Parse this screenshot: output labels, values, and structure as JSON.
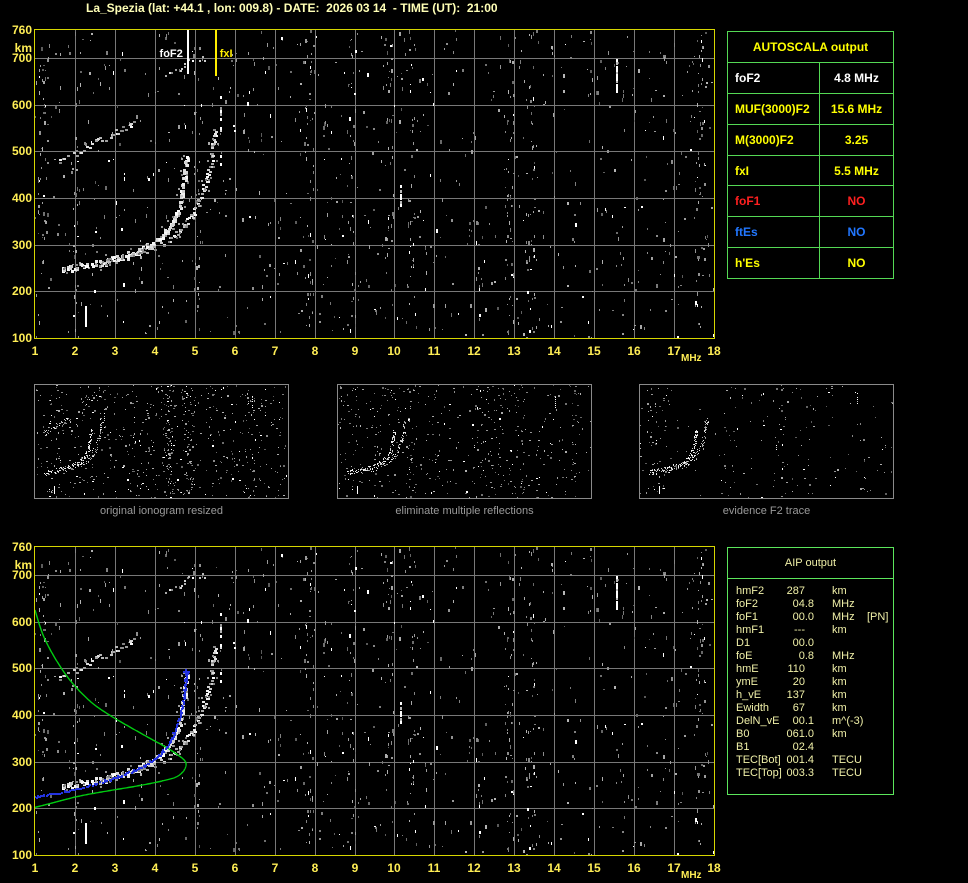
{
  "header": {
    "title": "La_Spezia (lat: +44.1 , lon: 009.8) - DATE:  2026 03 14  - TIME (UT):  21:00"
  },
  "colors": {
    "accent_yellow": "#ffee55",
    "pale_yellow": "#ffffb6",
    "plot_border": "#d6d600",
    "grid_gray": "#787878",
    "table_green": "#54d854",
    "profile_green": "#00cc11",
    "restored_blue": "#2433e0",
    "status_red": "#ff2020",
    "status_blue": "#2277ff"
  },
  "autoscala_table": {
    "title": "AUTOSCALA output",
    "rows": [
      {
        "label": "foF2",
        "value": "4.8 MHz",
        "color": "#ffffff"
      },
      {
        "label": "MUF(3000)F2",
        "value": "15.6 MHz",
        "color": "#ffff00"
      },
      {
        "label": "M(3000)F2",
        "value": "3.25",
        "color": "#ffff00"
      },
      {
        "label": "fxI",
        "value": "5.5 MHz",
        "color": "#ffff00"
      },
      {
        "label": "foF1",
        "value": "NO",
        "color": "#ff2020"
      },
      {
        "label": "ftEs",
        "value": "NO",
        "color": "#2277ff"
      },
      {
        "label": "h'Es",
        "value": "NO",
        "color": "#ffff00"
      }
    ]
  },
  "aip_table": {
    "title": "AIP output",
    "rows": [
      {
        "label": "hmF2",
        "value": "287",
        "unit": "km",
        "note": ""
      },
      {
        "label": "foF2",
        "value": "04.8",
        "unit": "MHz",
        "note": ""
      },
      {
        "label": "foF1",
        "value": "00.0",
        "unit": "MHz",
        "note": "[PN]"
      },
      {
        "label": "hmF1",
        "value": "---",
        "unit": "km",
        "note": ""
      },
      {
        "label": "D1",
        "value": "00.0",
        "unit": "",
        "note": ""
      },
      {
        "label": "foE",
        "value": "0.8",
        "unit": "MHz",
        "note": ""
      },
      {
        "label": "hmE",
        "value": "110",
        "unit": "km",
        "note": ""
      },
      {
        "label": "ymE",
        "value": "20",
        "unit": "km",
        "note": ""
      },
      {
        "label": "h_vE",
        "value": "137",
        "unit": "km",
        "note": ""
      },
      {
        "label": "Ewidth",
        "value": "67",
        "unit": "km",
        "note": ""
      },
      {
        "label": "DelN_vE",
        "value": "00.1",
        "unit": "m^(-3)",
        "note": ""
      },
      {
        "label": "B0",
        "value": "061.0",
        "unit": "km",
        "note": ""
      },
      {
        "label": "B1",
        "value": "02.4",
        "unit": "",
        "note": ""
      },
      {
        "label": "TEC[Bot]",
        "value": "001.4",
        "unit": "TECU",
        "note": ""
      },
      {
        "label": "TEC[Top]",
        "value": "003.3",
        "unit": "TECU",
        "note": ""
      }
    ]
  },
  "thumbnails": [
    {
      "caption": "original ionogram resized"
    },
    {
      "caption": "eliminate multiple reflections"
    },
    {
      "caption": "evidence F2 trace"
    }
  ],
  "chart_data": {
    "type": "scatter",
    "title": "Ionogram echo power map (two panels, identical background)",
    "xlabel": "MHz",
    "ylabel": "km",
    "xlim": [
      1,
      18
    ],
    "ylim": [
      100,
      760
    ],
    "x_ticks": [
      1,
      2,
      3,
      4,
      5,
      6,
      7,
      8,
      9,
      10,
      11,
      12,
      13,
      14,
      15,
      16,
      17,
      18
    ],
    "y_ticks": [
      760,
      700,
      600,
      500,
      400,
      300,
      200,
      100
    ],
    "grid": true,
    "markers": {
      "foF2": {
        "label": "foF2",
        "mhz": 4.8
      },
      "fxI": {
        "label": "fxI",
        "mhz": 5.5
      }
    },
    "traces": {
      "f2_ordinary": [
        [
          1.7,
          248
        ],
        [
          2.0,
          252
        ],
        [
          2.5,
          261
        ],
        [
          3.0,
          272
        ],
        [
          3.5,
          286
        ],
        [
          3.9,
          302
        ],
        [
          4.2,
          322
        ],
        [
          4.45,
          350
        ],
        [
          4.6,
          385
        ],
        [
          4.7,
          425
        ],
        [
          4.76,
          462
        ],
        [
          4.8,
          490
        ]
      ],
      "f2_extraordinary": [
        [
          2.6,
          258
        ],
        [
          3.0,
          266
        ],
        [
          3.5,
          278
        ],
        [
          4.0,
          294
        ],
        [
          4.4,
          314
        ],
        [
          4.7,
          338
        ],
        [
          4.95,
          368
        ],
        [
          5.15,
          405
        ],
        [
          5.3,
          445
        ],
        [
          5.4,
          480
        ],
        [
          5.45,
          512
        ],
        [
          5.5,
          548
        ]
      ],
      "second_hop": [
        [
          1.6,
          480
        ],
        [
          2.0,
          498
        ],
        [
          2.4,
          515
        ],
        [
          2.8,
          532
        ],
        [
          3.2,
          550
        ],
        [
          3.5,
          563
        ]
      ],
      "second_hop_cusp": {
        "mhz": 5.62,
        "km_from": 475,
        "km_to": 622
      },
      "upper_patch": [
        [
          4.25,
          655
        ],
        [
          4.6,
          675
        ],
        [
          4.9,
          690
        ],
        [
          5.3,
          702
        ]
      ],
      "es_line": {
        "mhz": 2.25,
        "km_from": 123,
        "km_to": 168
      },
      "lone_dot": {
        "mhz": 1.95,
        "km": 150
      },
      "rfi_streaks": [
        {
          "mhz": 10.15,
          "km_from": 388,
          "km_to": 428
        },
        {
          "mhz": 15.55,
          "km_from": 632,
          "km_to": 700
        }
      ]
    },
    "overlay": {
      "profile_green": [
        [
          1.0,
          625
        ],
        [
          1.2,
          572
        ],
        [
          1.5,
          522
        ],
        [
          1.9,
          472
        ],
        [
          2.4,
          428
        ],
        [
          2.9,
          398
        ],
        [
          3.4,
          373
        ],
        [
          3.9,
          349
        ],
        [
          4.3,
          330
        ],
        [
          4.6,
          313
        ],
        [
          4.75,
          302
        ],
        [
          4.78,
          292
        ],
        [
          4.7,
          278
        ],
        [
          4.5,
          266
        ],
        [
          4.1,
          257
        ],
        [
          3.5,
          247
        ],
        [
          2.8,
          237
        ],
        [
          2.1,
          226
        ],
        [
          1.5,
          213
        ],
        [
          1.0,
          202
        ]
      ],
      "restored_blue": [
        [
          1.0,
          227
        ],
        [
          1.3,
          230
        ],
        [
          1.7,
          236
        ],
        [
          2.1,
          245
        ],
        [
          2.5,
          254
        ],
        [
          2.9,
          264
        ],
        [
          3.2,
          273
        ],
        [
          3.5,
          284
        ],
        [
          3.8,
          297
        ],
        [
          4.05,
          312
        ],
        [
          4.25,
          330
        ],
        [
          4.4,
          350
        ],
        [
          4.52,
          374
        ],
        [
          4.62,
          400
        ],
        [
          4.69,
          428
        ],
        [
          4.73,
          455
        ],
        [
          4.76,
          478
        ],
        [
          4.78,
          492
        ]
      ]
    }
  }
}
